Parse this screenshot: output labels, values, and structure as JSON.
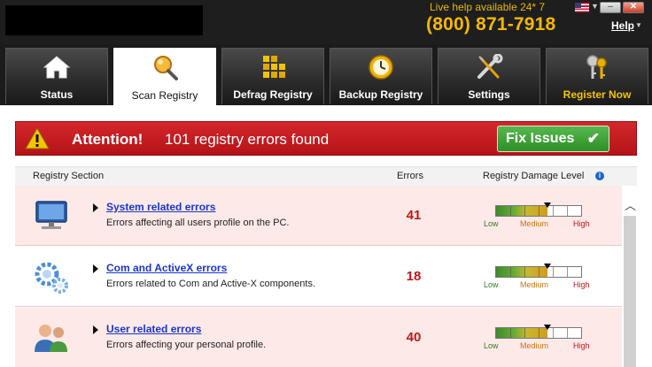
{
  "header": {
    "live_help": "Live help available 24* 7",
    "phone": "(800) 871-7918",
    "help": "Help",
    "window_controls": {
      "minimize": "–",
      "close": "✕"
    }
  },
  "tabs": [
    {
      "label": "Status",
      "icon": "house-icon",
      "active": false
    },
    {
      "label": "Scan Registry",
      "icon": "magnifier-icon",
      "active": true
    },
    {
      "label": "Defrag Registry",
      "icon": "blocks-icon",
      "active": false
    },
    {
      "label": "Backup Registry",
      "icon": "clock-icon",
      "active": false
    },
    {
      "label": "Settings",
      "icon": "wrench-screwdriver-icon",
      "active": false
    },
    {
      "label": "Register Now",
      "icon": "keys-icon",
      "active": false
    }
  ],
  "banner": {
    "attention": "Attention!",
    "message": "101 registry errors found",
    "fix_button": "Fix Issues",
    "fix_icon": "✔"
  },
  "table": {
    "headers": {
      "section": "Registry Section",
      "errors": "Errors",
      "damage": "Registry Damage Level"
    },
    "rows": [
      {
        "title": "System related errors",
        "description": "Errors affecting all users profile on the PC.",
        "errors": "41",
        "icon": "monitor-icon",
        "damage_level": 0.6
      },
      {
        "title": "Com and ActiveX errors",
        "description": "Errors related to Com and Active-X components.",
        "errors": "18",
        "icon": "gears-icon",
        "damage_level": 0.6
      },
      {
        "title": "User related errors",
        "description": "Errors affecting your personal profile.",
        "errors": "40",
        "icon": "users-icon",
        "damage_level": 0.6
      }
    ],
    "meter_labels": {
      "low": "Low",
      "medium": "Medium",
      "high": "High"
    }
  },
  "colors": {
    "accent": "#f5b800",
    "banner": "#c41e22",
    "fix_button": "#3a9c33",
    "link": "#1a36c8",
    "error_count": "#c41515"
  }
}
